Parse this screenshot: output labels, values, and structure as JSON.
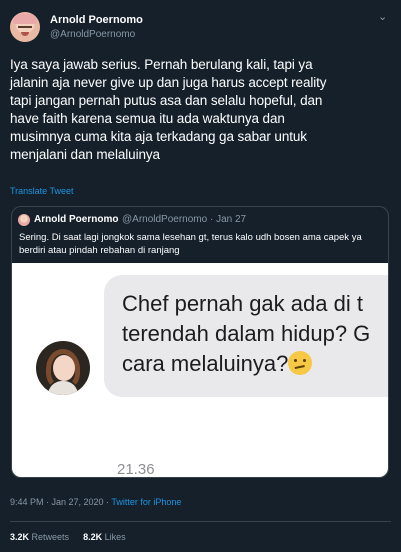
{
  "tweet": {
    "author_name": "Arnold Poernomo",
    "author_handle": "@ArnoldPoernomo",
    "more_icon": "chevron-down-icon",
    "lines": [
      "Iya saya jawab serius. Pernah berulang kali, tapi ya",
      "jalanin aja never give up dan juga harus accept reality",
      "tapi jangan pernah putus asa dan selalu hopeful, dan",
      "have faith karena semua itu ada waktunya dan",
      "musimnya cuma kita aja terkadang ga sabar untuk",
      "menjalani dan melaluinya"
    ],
    "translate_label": "Translate Tweet",
    "timestamp": "9:44 PM · Jan 27, 2020 · ",
    "source": "Twitter for iPhone",
    "retweets_count": "3.2K",
    "retweets_label": "Retweets",
    "likes_count": "8.2K",
    "likes_label": "Likes"
  },
  "quoted": {
    "author_name": "Arnold Poernomo",
    "meta": "@ArnoldPoernomo · Jan 27",
    "text": "Sering. Di saat lagi jongkok sama lesehan gt, terus kalo udh bosen ama capek ya berdiri atau pindah rebahan di ranjang",
    "image": {
      "chat_lines": [
        "Chef pernah gak ada di t",
        "terendah dalam hidup? G",
        "cara melaluinya?"
      ],
      "emoji": "confused-face-emoji",
      "chat_time": "21.36"
    }
  },
  "colors": {
    "background": "#15202b",
    "text": "#ffffff",
    "secondary": "#8899a6",
    "link": "#1b95e0",
    "border": "#38444d"
  }
}
